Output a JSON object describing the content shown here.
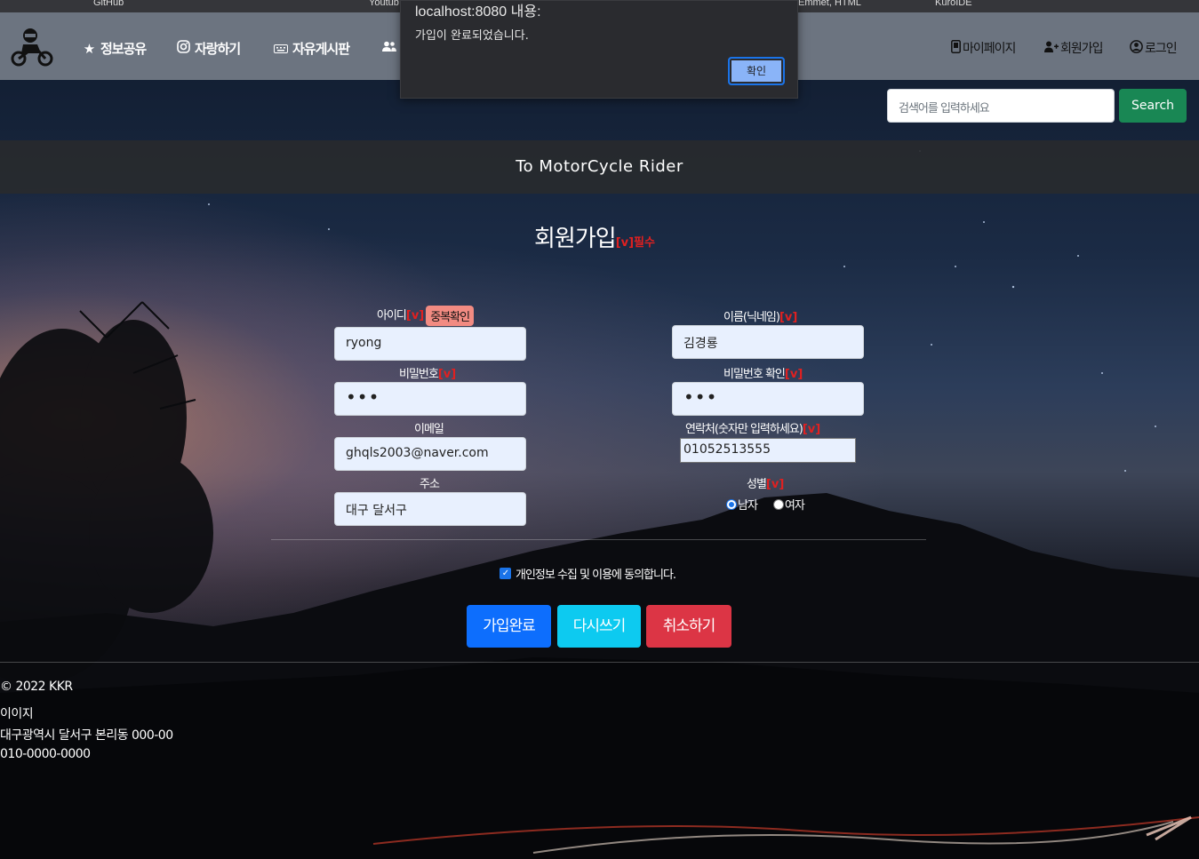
{
  "bookmarks": [
    "GitHub",
    "Youtub",
    "Emmet, HTML",
    "KuroIDE"
  ],
  "dialog": {
    "title": "localhost:8080 내용:",
    "message": "가입이 완료되었습니다.",
    "ok_label": "확인"
  },
  "nav": {
    "links": [
      {
        "label": "정보공유",
        "icon": "star-icon"
      },
      {
        "label": "자랑하기",
        "icon": "instagram-icon"
      },
      {
        "label": "자유게시판",
        "icon": "keyboard-icon"
      },
      {
        "label": "",
        "icon": "people-icon"
      }
    ],
    "right": [
      {
        "label": "마이페이지",
        "icon": "phone-icon"
      },
      {
        "label": "회원가입",
        "icon": "person-plus-icon"
      },
      {
        "label": "로그인",
        "icon": "person-circle-icon"
      }
    ]
  },
  "search": {
    "placeholder": "검색어를 입력하세요",
    "button_label": "Search"
  },
  "banner": "To MotorCycle Rider",
  "form": {
    "title": "회원가입",
    "required_note": "[v]필수",
    "req_mark": "[v]",
    "id": {
      "label": "아이디",
      "value": "ryong",
      "dup_button": "중복확인"
    },
    "name": {
      "label": "이름(닉네임)",
      "value": "김경룡"
    },
    "password": {
      "label": "비밀번호",
      "value": "•••"
    },
    "password_confirm": {
      "label": "비밀번호 확인",
      "value": "•••"
    },
    "email": {
      "label": "이메일",
      "value": "ghqls2003@naver.com"
    },
    "phone": {
      "label": "연락처(숫자만 입력하세요)",
      "value": "01052513555"
    },
    "address": {
      "label": "주소",
      "value": "대구 달서구"
    },
    "gender": {
      "label": "성별",
      "options": [
        "남자",
        "여자"
      ],
      "selected": "남자"
    },
    "agree_label": "개인정보 수집 및 이용에 동의합니다.",
    "agree_checked": true,
    "buttons": {
      "submit": "가입완료",
      "reset": "다시쓰기",
      "cancel": "취소하기"
    }
  },
  "footer": {
    "copyright": "© 2022 KKR",
    "name": "이이지",
    "address": "대구광역시 달서구 본리동 000-00",
    "phone": "010-0000-0000"
  },
  "colors": {
    "navbar": "#6c7480",
    "primary": "#0d6efd",
    "info": "#0dcaf0",
    "danger": "#dc3545",
    "success": "#198754",
    "required": "#e02020"
  }
}
